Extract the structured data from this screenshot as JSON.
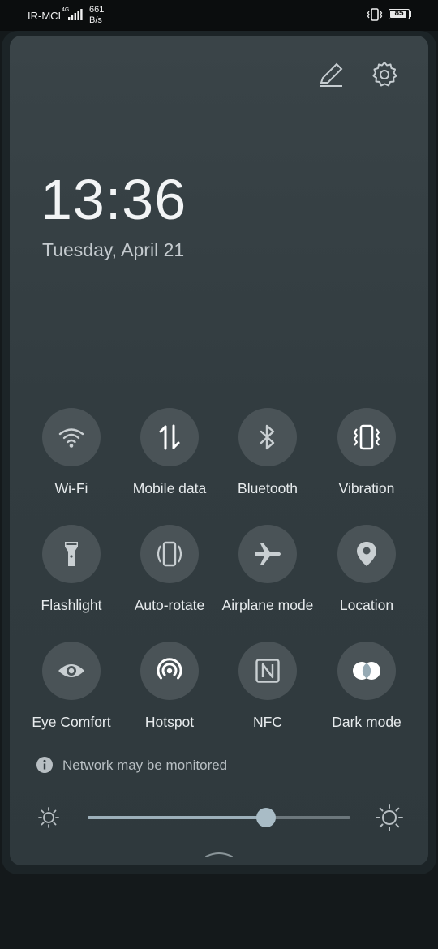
{
  "status_bar": {
    "carrier": "IR-MCI",
    "network_type": "4G",
    "speed_value": "661",
    "speed_unit": "B/s",
    "battery_level": "85",
    "icons": [
      "signal-icon",
      "vibration-status-icon",
      "battery-icon"
    ]
  },
  "header": {
    "icons": [
      "edit-icon",
      "settings-icon"
    ]
  },
  "clock": {
    "time": "13:36",
    "date": "Tuesday, April 21"
  },
  "tiles": [
    {
      "label": "Wi-Fi",
      "icon": "wifi-icon",
      "active": false
    },
    {
      "label": "Mobile data",
      "icon": "mobile-data-icon",
      "active": true
    },
    {
      "label": "Bluetooth",
      "icon": "bluetooth-icon",
      "active": false
    },
    {
      "label": "Vibration",
      "icon": "vibration-icon",
      "active": true
    },
    {
      "label": "Flashlight",
      "icon": "flashlight-icon",
      "active": false
    },
    {
      "label": "Auto-rotate",
      "icon": "auto-rotate-icon",
      "active": false
    },
    {
      "label": "Airplane mode",
      "icon": "airplane-icon",
      "active": false
    },
    {
      "label": "Location",
      "icon": "location-icon",
      "active": false
    },
    {
      "label": "Eye Comfort",
      "icon": "eye-icon",
      "active": false
    },
    {
      "label": "Hotspot",
      "icon": "hotspot-icon",
      "active": true
    },
    {
      "label": "NFC",
      "icon": "nfc-icon",
      "active": false
    },
    {
      "label": "Dark mode",
      "icon": "dark-mode-icon",
      "active": true
    }
  ],
  "notice": {
    "icon": "info-icon",
    "text": "Network may be monitored"
  },
  "brightness": {
    "level": 0.68,
    "icons": [
      "brightness-low-icon",
      "brightness-high-icon"
    ]
  },
  "colors": {
    "tile_on": "#96aab4",
    "tile_off": "#4a5357",
    "panel": "#353f43"
  }
}
